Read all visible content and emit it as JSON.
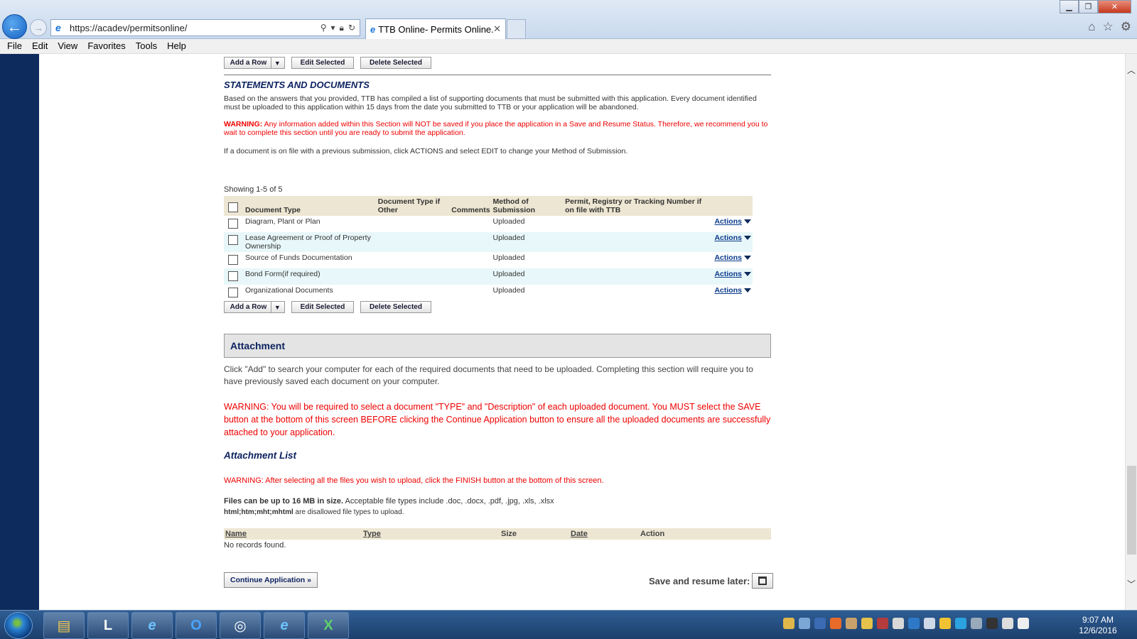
{
  "browser": {
    "url": "https://acadev/permitsonline/",
    "tab_title": "TTB Online- Permits Online...",
    "menu": [
      "File",
      "Edit",
      "View",
      "Favorites",
      "Tools",
      "Help"
    ]
  },
  "top_buttons": {
    "add_row": "Add a Row",
    "edit_selected": "Edit Selected",
    "delete_selected": "Delete Selected"
  },
  "statements": {
    "heading": "STATEMENTS AND DOCUMENTS",
    "intro": "Based on the answers that you provided, TTB has compiled a list of supporting documents that must be submitted with this application. Every document identified must be uploaded to this application within 15 days from the date you submitted to TTB or your application will be abandoned.",
    "warning_label": "WARNING:",
    "warning_text": " Any information added within this Section will NOT be saved if you place the application in a Save and Resume Status. Therefore, we recommend you to wait to complete this section until you are ready to submit the application.",
    "note": "If a document is on file with a previous submission, click ACTIONS and select EDIT to change your Method of Submission.",
    "showing": "Showing 1-5 of 5",
    "columns": {
      "doc_type": "Document Type",
      "doc_type_other": "Document Type if Other",
      "comments": "Comments",
      "method": "Method of Submission",
      "permit": "Permit, Registry or Tracking Number if on file with TTB"
    },
    "rows": [
      {
        "doc_type": "Diagram, Plant or Plan",
        "method": "Uploaded",
        "action": "Actions"
      },
      {
        "doc_type": "Lease Agreement or Proof of Property Ownership",
        "method": "Uploaded",
        "action": "Actions"
      },
      {
        "doc_type": "Source of Funds Documentation",
        "method": "Uploaded",
        "action": "Actions"
      },
      {
        "doc_type": "Bond Form(if required)",
        "method": "Uploaded",
        "action": "Actions"
      },
      {
        "doc_type": "Organizational Documents",
        "method": "Uploaded",
        "action": "Actions"
      }
    ]
  },
  "attachment": {
    "heading": "Attachment",
    "intro": "Click \"Add\" to search your computer for each of the required documents that need to be uploaded.  Completing this section will require you to have previously saved each document on your computer.",
    "warning": "WARNING: You will be required to select a document \"TYPE\" and \"Description\" of each uploaded document. You MUST select the SAVE button at the bottom of this screen BEFORE clicking the Continue Application button to ensure all the uploaded documents are successfully attached to your application.",
    "list_heading": "Attachment List",
    "list_warning": "WARNING: After selecting all the files you wish to upload, click the FINISH button at the bottom of this screen.",
    "size_bold": "Files can be up to 16 MB in size.",
    "size_text": " Acceptable file types include .doc, .docx, .pdf, .jpg, .xls, .xlsx",
    "disallowed_bold": "html;htm;mht;mhtml",
    "disallowed_text": " are disallowed file types to upload.",
    "columns": {
      "name": "Name",
      "type": "Type",
      "size": "Size",
      "date": "Date",
      "action": "Action"
    },
    "empty": "No records found."
  },
  "footer": {
    "continue": "Continue Application »",
    "save_later": "Save and resume later:"
  },
  "taskbar": {
    "time": "9:07 AM",
    "date": "12/6/2016"
  },
  "colors": {
    "nav_blue": "#0d2b5c",
    "warning_red": "#e00000",
    "table_header": "#ede6d2",
    "row_alt": "#e8f7f9"
  }
}
